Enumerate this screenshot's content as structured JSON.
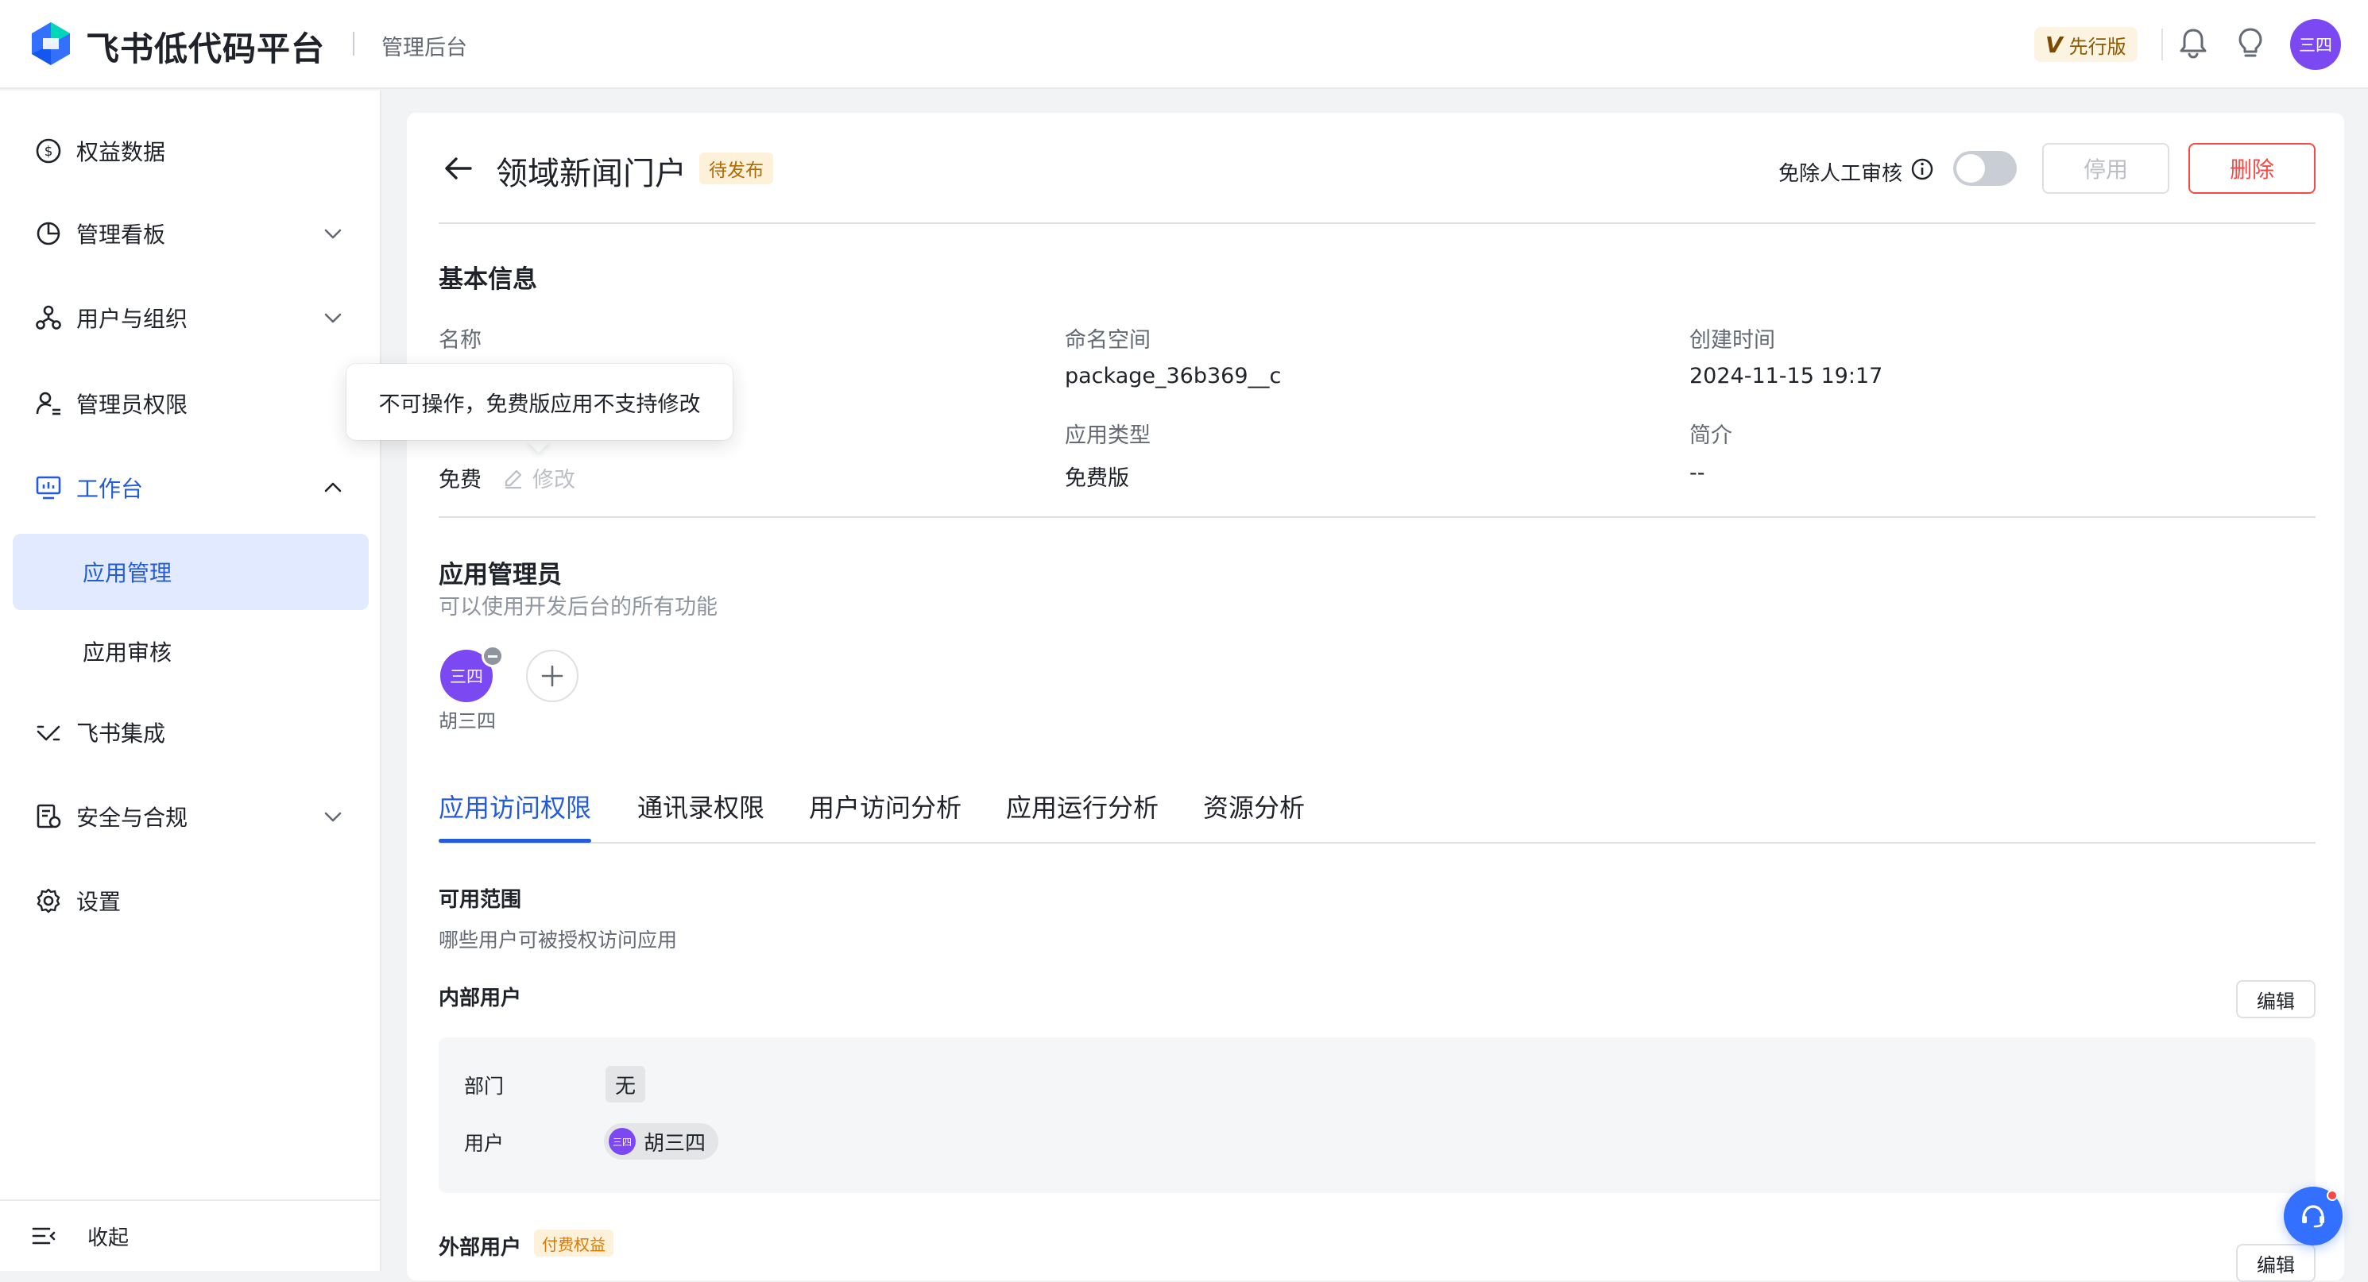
{
  "header": {
    "brand": "飞书低代码平台",
    "subtitle": "管理后台",
    "edition_badge_v": "V",
    "edition_badge": "先行版",
    "avatar_text": "三四"
  },
  "sidebar": {
    "items": [
      {
        "label": "权益数据",
        "icon": "dollar-circle-icon"
      },
      {
        "label": "管理看板",
        "icon": "pie-chart-icon"
      },
      {
        "label": "用户与组织",
        "icon": "org-icon"
      },
      {
        "label": "管理员权限",
        "icon": "admin-user-icon"
      },
      {
        "label": "工作台",
        "icon": "monitor-icon"
      },
      {
        "label": "飞书集成",
        "icon": "integration-icon"
      },
      {
        "label": "安全与合规",
        "icon": "security-doc-icon"
      },
      {
        "label": "设置",
        "icon": "gear-icon"
      }
    ],
    "sub_items": [
      {
        "label": "应用管理"
      },
      {
        "label": "应用审核"
      }
    ],
    "collapse_label": "收起"
  },
  "page": {
    "title": "领域新闻门户",
    "status": "待发布",
    "audit_label": "免除人工审核",
    "disable_label": "停用",
    "delete_label": "删除"
  },
  "basic_info": {
    "title": "基本信息",
    "name_label": "名称",
    "namespace_label": "命名空间",
    "namespace_value": "package_36b369__c",
    "created_label": "创建时间",
    "created_value": "2024-11-15 19:17",
    "fee_value": "免费",
    "edit_label": "修改",
    "app_type_label": "应用类型",
    "app_type_value": "免费版",
    "intro_label": "简介",
    "intro_value": "--"
  },
  "tooltip": {
    "text": "不可操作，免费版应用不支持修改"
  },
  "admins": {
    "title": "应用管理员",
    "desc": "可以使用开发后台的所有功能",
    "avatar_text": "三四",
    "name": "胡三四"
  },
  "tabs": [
    {
      "label": "应用访问权限"
    },
    {
      "label": "通讯录权限"
    },
    {
      "label": "用户访问分析"
    },
    {
      "label": "应用运行分析"
    },
    {
      "label": "资源分析"
    }
  ],
  "access": {
    "scope_title": "可用范围",
    "scope_desc": "哪些用户可被授权访问应用",
    "internal_title": "内部用户",
    "edit_label": "编辑",
    "dept_label": "部门",
    "dept_value": "无",
    "user_label": "用户",
    "user_avatar_text": "三四",
    "user_value": "胡三四",
    "external_title": "外部用户",
    "paid_tag": "付费权益"
  },
  "colors": {
    "primary": "#245bdb",
    "danger": "#f54a45",
    "avatar": "#7b48f2",
    "status_tag_bg": "#fdf2d9"
  }
}
